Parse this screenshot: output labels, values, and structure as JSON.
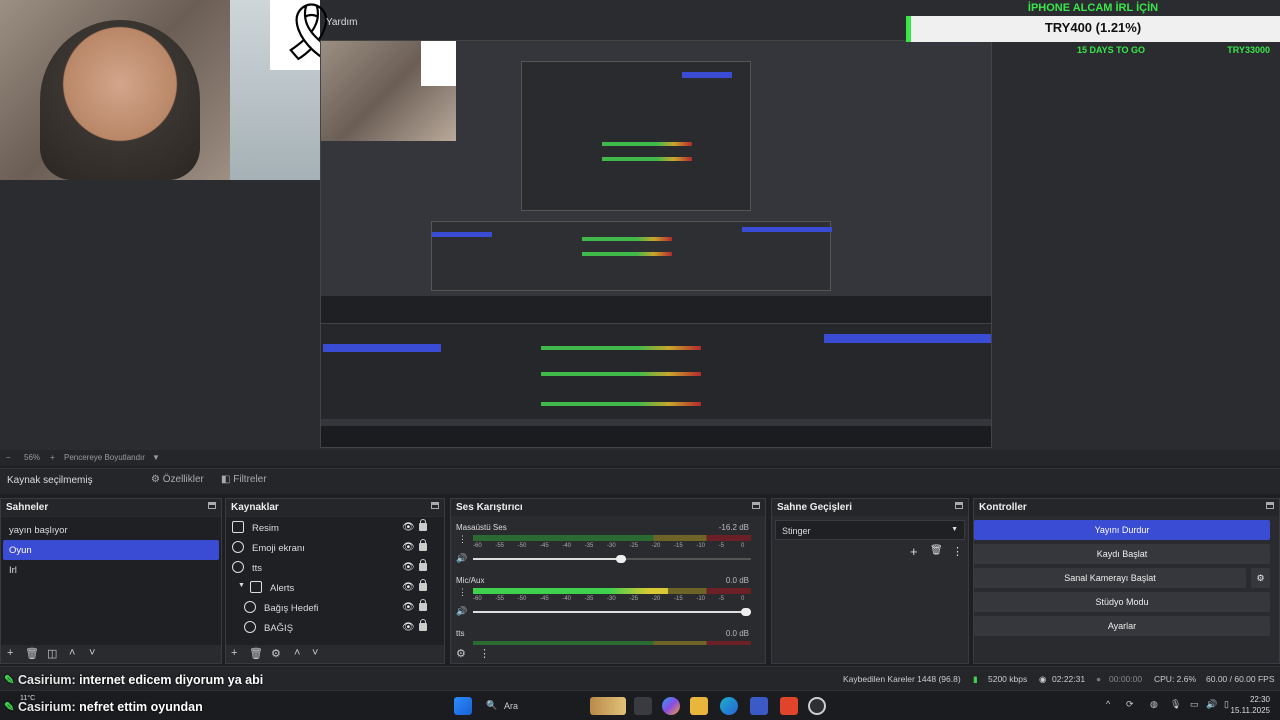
{
  "app": {
    "help_menu": "Yardım"
  },
  "donation": {
    "title": "İPHONE ALCAM İRL İÇİN",
    "amount": "TRY400 (1.21%)",
    "progress_percent": 1.21,
    "days_left": "15 DAYS TO GO",
    "goal": "TRY33000",
    "accent": "#39e64a"
  },
  "preview_bar": {
    "zoom": "56%",
    "fit": "Pencereye Boyutlandır"
  },
  "source_bar": {
    "no_source": "Kaynak seçilmemiş",
    "properties": "Özellikler",
    "filters": "Filtreler"
  },
  "scenes": {
    "title": "Sahneler",
    "items": [
      "yayın başlıyor",
      "Oyun",
      "Irl"
    ],
    "selected_index": 1
  },
  "sources": {
    "title": "Kaynaklar",
    "items": [
      {
        "label": "Resim",
        "icon": "image-icon",
        "indent": 0
      },
      {
        "label": "Emoji ekranı",
        "icon": "globe-icon",
        "indent": 0
      },
      {
        "label": "tts",
        "icon": "globe-icon",
        "indent": 0
      },
      {
        "label": "Alerts",
        "icon": "folder-icon",
        "indent": 1,
        "group": true
      },
      {
        "label": "Bağış Hedefi",
        "icon": "globe-icon",
        "indent": 2
      },
      {
        "label": "BAĞIŞ",
        "icon": "globe-icon",
        "indent": 2
      }
    ]
  },
  "mixer": {
    "title": "Ses Karıştırıcı",
    "ticks": [
      "-60",
      "-55",
      "-50",
      "-45",
      "-40",
      "-35",
      "-30",
      "-25",
      "-20",
      "-15",
      "-10",
      "-5",
      "0"
    ],
    "tracks": [
      {
        "name": "Masaüstü Ses",
        "db": "-16.2 dB",
        "level": 0.0,
        "volume": 0.55
      },
      {
        "name": "Mic/Aux",
        "db": "0.0 dB",
        "level": 0.7,
        "volume": 1.0
      },
      {
        "name": "tts",
        "db": "0.0 dB",
        "level": 0.0,
        "volume": 1.0
      }
    ]
  },
  "transitions": {
    "title": "Sahne Geçişleri",
    "selected": "Stinger"
  },
  "controls": {
    "title": "Kontroller",
    "stop_stream": "Yayını Durdur",
    "start_recording": "Kaydı Başlat",
    "virtual_camera": "Sanal Kamerayı Başlat",
    "studio_mode": "Stüdyo Modu",
    "settings": "Ayarlar"
  },
  "status": {
    "dropped_frames": "Kaybedilen Kareler 1448 (96.8)",
    "bitrate": "5200 kbps",
    "stream_time": "02:22:31",
    "record_time": "00:00:00",
    "cpu": "CPU: 2.6%",
    "fps": "60.00 / 60.00 FPS"
  },
  "chat": [
    {
      "user": "Casirium:",
      "message": "internet edicem diyorum ya abi"
    },
    {
      "user": "Casirium:",
      "message": "nefret ettim oyundan"
    }
  ],
  "taskbar": {
    "search": "Ara",
    "weather": "11°C",
    "time": "22:30",
    "date": "15.11.2025"
  }
}
